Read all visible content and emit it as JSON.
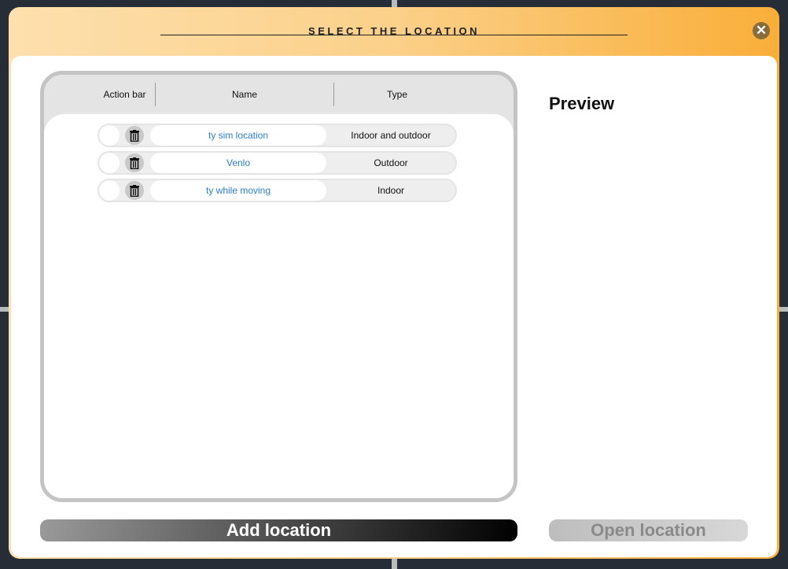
{
  "dialog": {
    "title": "SELECT THE LOCATION",
    "close_icon": "close-icon"
  },
  "table": {
    "headers": [
      "Action bar",
      "Name",
      "Type"
    ],
    "rows": [
      {
        "name": "ty sim location",
        "type": "Indoor and outdoor"
      },
      {
        "name": "Venlo",
        "type": "Outdoor"
      },
      {
        "name": "ty while moving",
        "type": "Indoor"
      }
    ]
  },
  "preview": {
    "title": "Preview"
  },
  "buttons": {
    "add": "Add location",
    "open": "Open location"
  },
  "colors": {
    "accent": "#f9ae38",
    "link": "#2b7fd0"
  }
}
